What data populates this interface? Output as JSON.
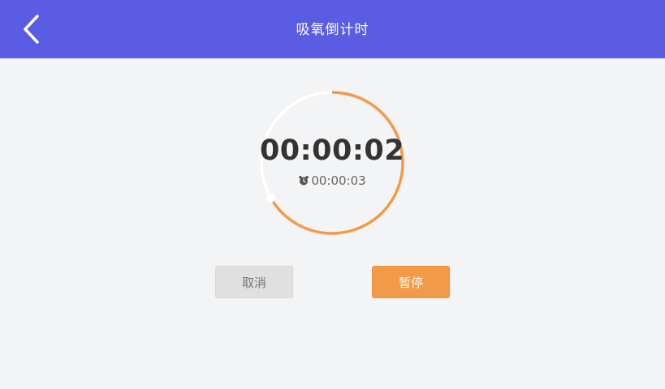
{
  "header": {
    "title": "吸氧倒计时",
    "background": "#5a5ce3"
  },
  "timer": {
    "elapsed": "00:00:02",
    "total": "00:00:03",
    "progress_fraction": 0.667,
    "progress_color": "#f39a48",
    "track_color": "#ffffff"
  },
  "buttons": {
    "cancel_label": "取消",
    "pause_label": "暂停",
    "pause_color": "#f39a48"
  },
  "icons": {
    "back": "chevron-left-icon",
    "alarm": "alarm-clock-icon"
  }
}
